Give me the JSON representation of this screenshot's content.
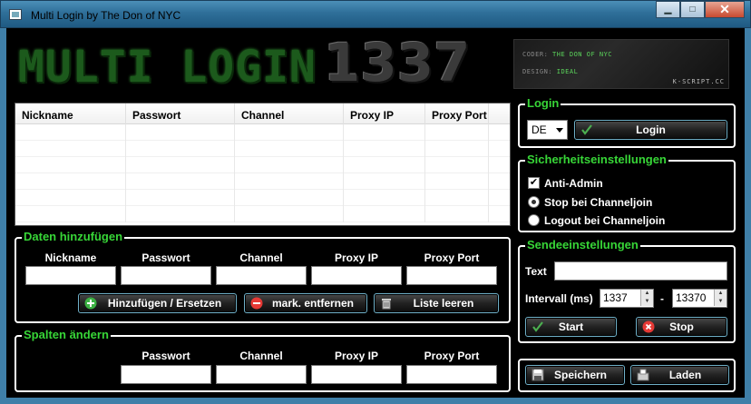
{
  "window": {
    "title": "Multi Login by The Don of NYC"
  },
  "logo": {
    "text": "MULTI LOGIN",
    "number": "1337"
  },
  "credits": {
    "coder_label": "CODER:",
    "coder_value": "THE DON OF NYC",
    "design_label": "DESIGN:",
    "design_value": "IDEAL",
    "site": "K-SCRIPT.CC"
  },
  "accounts_table": {
    "columns": [
      "Nickname",
      "Passwort",
      "Channel",
      "Proxy IP",
      "Proxy Port"
    ],
    "rows": [
      [
        "",
        "",
        "",
        "",
        ""
      ],
      [
        "",
        "",
        "",
        "",
        ""
      ],
      [
        "",
        "",
        "",
        "",
        ""
      ],
      [
        "",
        "",
        "",
        "",
        ""
      ],
      [
        "",
        "",
        "",
        "",
        ""
      ],
      [
        "",
        "",
        "",
        "",
        ""
      ]
    ]
  },
  "add_data": {
    "legend": "Daten hinzufügen",
    "labels": [
      "Nickname",
      "Passwort",
      "Channel",
      "Proxy IP",
      "Proxy Port"
    ],
    "values": [
      "",
      "",
      "",
      "",
      ""
    ],
    "add_button": "Hinzufügen / Ersetzen",
    "remove_button": "mark. entfernen",
    "clear_button": "Liste leeren"
  },
  "edit_columns": {
    "legend": "Spalten ändern",
    "labels": [
      "Passwort",
      "Channel",
      "Proxy IP",
      "Proxy Port"
    ],
    "values": [
      "",
      "",
      "",
      ""
    ]
  },
  "login": {
    "legend": "Login",
    "region_value": "DE",
    "login_button": "Login"
  },
  "security": {
    "legend": "Sicherheitseinstellungen",
    "anti_admin": "Anti-Admin",
    "anti_admin_checked": true,
    "stop_on_join": "Stop bei Channeljoin",
    "logout_on_join": "Logout bei Channeljoin",
    "selected": "stop"
  },
  "send": {
    "legend": "Sendeeinstellungen",
    "text_label": "Text",
    "text_value": "",
    "interval_label": "Intervall (ms)",
    "interval_from": "1337",
    "interval_sep": "-",
    "interval_to": "13370",
    "start_button": "Start",
    "stop_button": "Stop"
  },
  "footer": {
    "save_button": "Speichern",
    "load_button": "Laden"
  },
  "colors": {
    "accent_green": "#37d637",
    "button_border": "#6fb0c8",
    "titlebar": "#2f6f99"
  }
}
